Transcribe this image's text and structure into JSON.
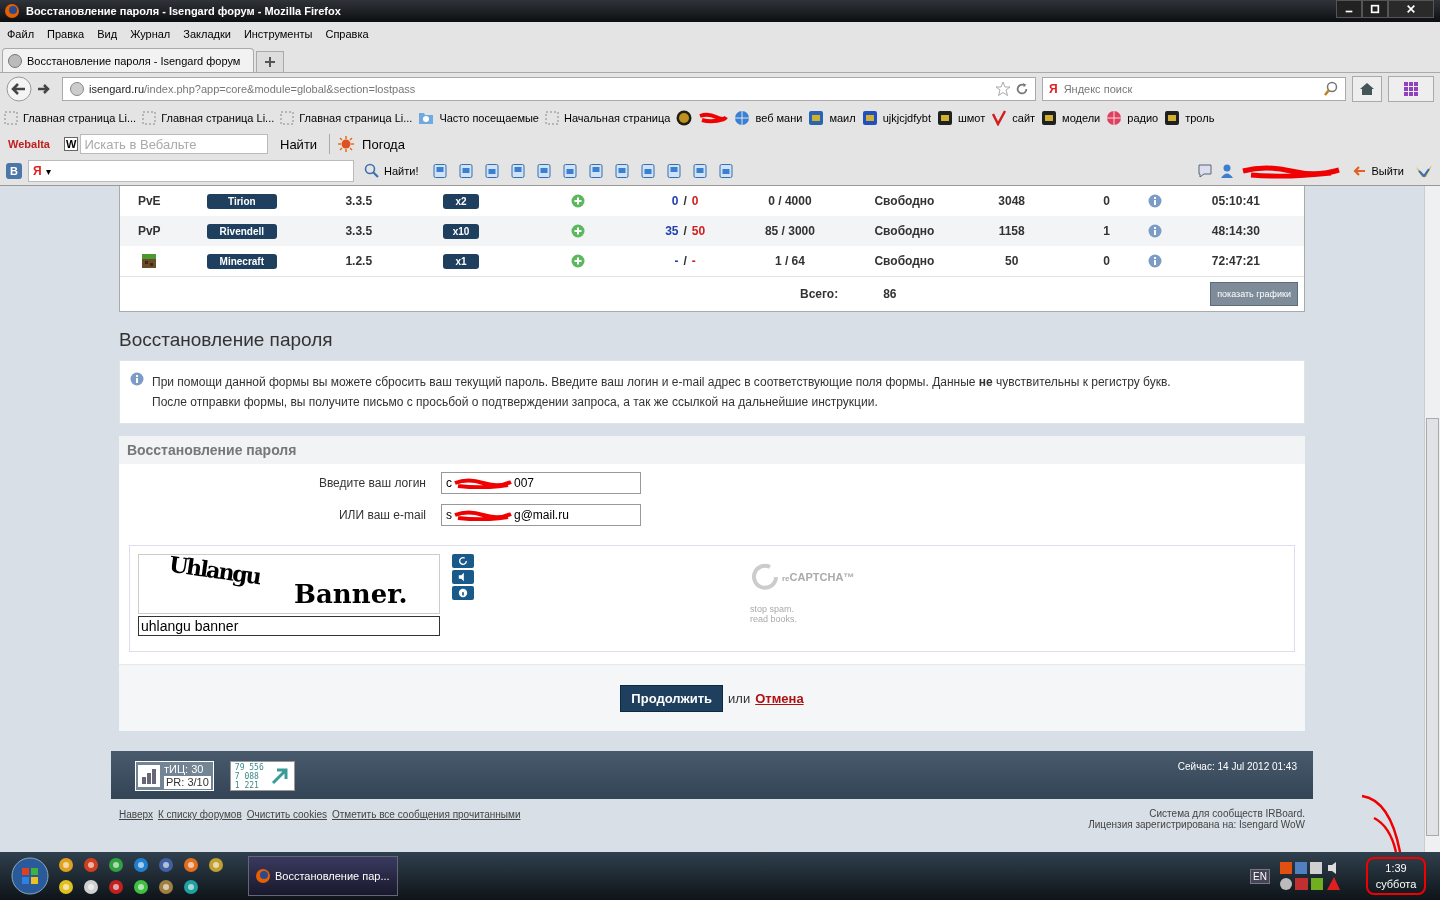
{
  "window": {
    "title": "Восстановление пароля - Isengard форум - Mozilla Firefox"
  },
  "menu": [
    "Файл",
    "Правка",
    "Вид",
    "Журнал",
    "Закладки",
    "Инструменты",
    "Справка"
  ],
  "tabs": [
    {
      "title": "Восстановление пароля - Isengard форум",
      "selected": true
    }
  ],
  "address": {
    "host": "isengard.ru",
    "path": "/index.php?app=core&module=global&section=lostpass"
  },
  "search": {
    "logo": "Я",
    "placeholder": "Яндекс поиск"
  },
  "bookmarks": [
    {
      "kind": "page",
      "label": "Главная страница Li..."
    },
    {
      "kind": "page",
      "label": "Главная страница Li..."
    },
    {
      "kind": "page",
      "label": "Главная страница Li..."
    },
    {
      "kind": "folder",
      "label": "Часто посещаемые"
    },
    {
      "kind": "page",
      "label": "Начальная страница"
    },
    {
      "kind": "emblem"
    },
    {
      "kind": "scribble"
    },
    {
      "kind": "globe",
      "label": "веб мани"
    },
    {
      "kind": "at",
      "label": "маил"
    },
    {
      "kind": "letter",
      "label": "ujkjcjdfybt"
    },
    {
      "kind": "tile",
      "label": "шмот"
    },
    {
      "kind": "check",
      "label": "сайт"
    },
    {
      "kind": "tile",
      "label": "модели"
    },
    {
      "kind": "drop",
      "label": "радио"
    },
    {
      "kind": "tile",
      "label": "троль"
    }
  ],
  "webalta_bar": {
    "logo": "Webalta",
    "badge": "W",
    "placeholder": "Искать в Вебальте",
    "find": "Найти",
    "weather": "Погода"
  },
  "yandex_bar": {
    "vk": "B",
    "logo": "Я",
    "dropdown": "▾",
    "find": "Найти!",
    "logout": "Выйти"
  },
  "servers": [
    {
      "kind": "text",
      "type": "PvE",
      "realm": "Tirion",
      "version": "3.3.5",
      "rate": "x2",
      "alliance": "0",
      "separator": "/",
      "horde": "0",
      "load": "0 / 4000",
      "status": "Свободно",
      "count": "3048",
      "queue": "0",
      "uptime": "05:10:41"
    },
    {
      "kind": "text",
      "type": "PvP",
      "realm": "Rivendell",
      "version": "3.3.5",
      "rate": "x10",
      "alliance": "35",
      "separator": "/",
      "horde": "50",
      "load": "85 / 3000",
      "status": "Свободно",
      "count": "1158",
      "queue": "1",
      "uptime": "48:14:30"
    },
    {
      "kind": "icon",
      "realm": "Minecraft",
      "version": "1.2.5",
      "rate": "x1",
      "alliance": "-",
      "separator": "/",
      "horde": "-",
      "load": "1 / 64",
      "status": "Свободно",
      "count": "50",
      "queue": "0",
      "uptime": "72:47:21"
    }
  ],
  "total": {
    "label": "Всего:",
    "value": "86",
    "button": "показать графики"
  },
  "page_title": "Восстановление пароля",
  "notice": [
    "При помощи данной формы вы можете сбросить ваш текущий пароль. Введите ваш логин и e-mail адрес в соответствующие поля формы. Данные **не** чувствительны к регистру букв.",
    "После отправки формы, вы получите письмо с просьбой о подтверждении запроса, а так же ссылкой на дальнейшие инструкции."
  ],
  "form": {
    "title": "Восстановление пароля",
    "fields": [
      {
        "label": "Введите ваш логин",
        "value_start": "c",
        "value_end": "007"
      },
      {
        "label": "ИЛИ ваш e-mail",
        "value_start": "s",
        "value_end": "g@mail.ru"
      }
    ]
  },
  "captcha": {
    "words": [
      "Uhlangu",
      "Banner."
    ],
    "answer": "uhlangu banner",
    "brand_prefix": "re",
    "brand": "CAPTCHA™",
    "slogan": [
      "stop spam.",
      "read books."
    ]
  },
  "actions": {
    "submit": "Продолжить",
    "or": "или",
    "cancel": "Отмена"
  },
  "footer": {
    "tic": "тИЦ: 30",
    "pr": "PR: 3/10",
    "counter": [
      "79 556",
      "7 088",
      "1 221"
    ],
    "now": "Сейчас: 14 Jul 2012 01:43",
    "links": [
      "Наверх",
      "К списку форумов",
      "Очистить cookies",
      "Отметить все сообщения прочитанными"
    ],
    "credits": [
      "Система для сообществ IRBoard.",
      "Лицензия зарегистрирована на: Isengard WoW"
    ]
  },
  "taskbar": {
    "task": "Восстановление пар...",
    "lang": "EN",
    "time": "1:39",
    "day": "суббота"
  }
}
